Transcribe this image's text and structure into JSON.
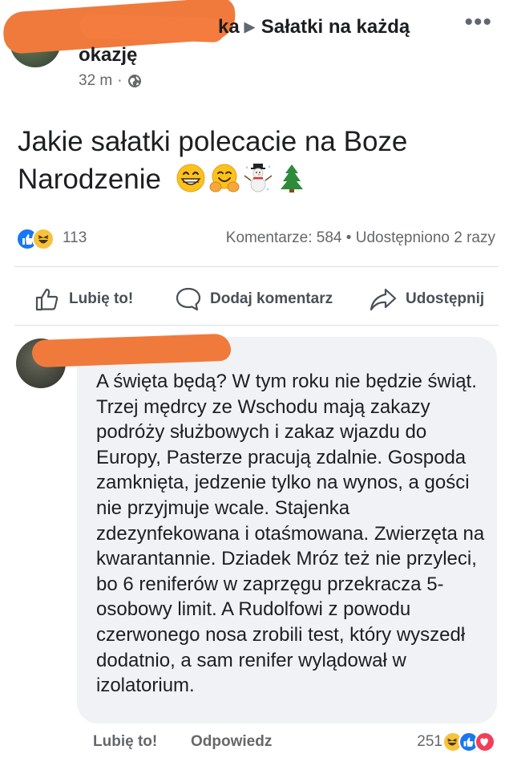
{
  "post": {
    "group_name_fragment": "ka",
    "group_title_line1": "Sałatki na każdą",
    "group_title_line2": "okazję",
    "time": "32 m",
    "meta_separator": "·",
    "body": "Jakie sałatki polecacie na Boze Narodzenie",
    "emojis": [
      "grinning-face-emoji",
      "hugging-face-emoji",
      "snowman-emoji",
      "christmas-tree-emoji"
    ],
    "more_icon": "•••"
  },
  "stats": {
    "reaction_count": "113",
    "comments": "Komentarze: 584",
    "separator": "•",
    "shares": "Udostępniono 2 razy"
  },
  "actions": {
    "like": "Lubię to!",
    "comment": "Dodaj komentarz",
    "share": "Udostępnij"
  },
  "comment": {
    "text": "A święta będą? W tym roku nie będzie świąt. Trzej mędrcy ze Wschodu mają zakazy podróży służbowych i zakaz wjazdu do Europy, Pasterze pracują zdalnie. Gospoda zamknięta, jedzenie tylko na wynos, a gości nie przyjmuje wcale. Stajenka zdezynfekowana i otaśmowana. Zwierzęta na kwarantannie. Dziadek Mróz też nie przyleci, bo 6 reniferów w zaprzęgu przekracza 5-osobowy limit. A Rudolfowi z powodu czerwonego nosa zrobili test, który wyszedł dodatnio, a sam renifer wylądował w izolatorium.",
    "like": "Lubię to!",
    "reply": "Odpowiedz",
    "reaction_count": "251"
  },
  "colors": {
    "facebook_blue": "#1877f2",
    "haha_yellow": "#f7c33c",
    "love_red": "#f33e58",
    "redaction_orange": "#f07a3c",
    "bubble_bg": "#f0f2f5",
    "muted_text": "#65676b"
  }
}
